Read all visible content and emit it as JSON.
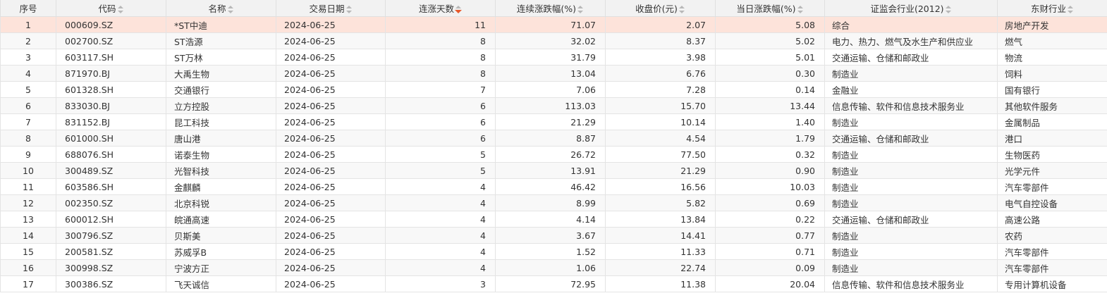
{
  "table": {
    "columns": {
      "idx": "序号",
      "code": "代码",
      "name": "名称",
      "date": "交易日期",
      "days": "连涨天数",
      "gain": "连续涨跌幅(%)",
      "close": "收盘价(元)",
      "daily": "当日涨跌幅(%)",
      "csrc": "证监会行业(2012)",
      "em": "东财行业"
    },
    "sorted_column": "days",
    "sort_direction": "desc",
    "selected_row": 1,
    "accent_color": "#e8592b",
    "selected_row_color": "#fde3da",
    "rows": [
      {
        "idx": "1",
        "code": "000609.SZ",
        "name": "*ST中迪",
        "date": "2024-06-25",
        "days": "11",
        "gain": "71.07",
        "close": "2.07",
        "daily": "5.08",
        "csrc": "综合",
        "em": "房地产开发"
      },
      {
        "idx": "2",
        "code": "002700.SZ",
        "name": "ST浩源",
        "date": "2024-06-25",
        "days": "8",
        "gain": "32.02",
        "close": "8.37",
        "daily": "5.02",
        "csrc": "电力、热力、燃气及水生产和供应业",
        "em": "燃气"
      },
      {
        "idx": "3",
        "code": "603117.SH",
        "name": "ST万林",
        "date": "2024-06-25",
        "days": "8",
        "gain": "31.79",
        "close": "3.98",
        "daily": "5.01",
        "csrc": "交通运输、仓储和邮政业",
        "em": "物流"
      },
      {
        "idx": "4",
        "code": "871970.BJ",
        "name": "大禹生物",
        "date": "2024-06-25",
        "days": "8",
        "gain": "13.04",
        "close": "6.76",
        "daily": "0.30",
        "csrc": "制造业",
        "em": "饲料"
      },
      {
        "idx": "5",
        "code": "601328.SH",
        "name": "交通银行",
        "date": "2024-06-25",
        "days": "7",
        "gain": "7.06",
        "close": "7.28",
        "daily": "0.14",
        "csrc": "金融业",
        "em": "国有银行"
      },
      {
        "idx": "6",
        "code": "833030.BJ",
        "name": "立方控股",
        "date": "2024-06-25",
        "days": "6",
        "gain": "113.03",
        "close": "15.70",
        "daily": "13.44",
        "csrc": "信息传输、软件和信息技术服务业",
        "em": "其他软件服务"
      },
      {
        "idx": "7",
        "code": "831152.BJ",
        "name": "昆工科技",
        "date": "2024-06-25",
        "days": "6",
        "gain": "21.29",
        "close": "10.14",
        "daily": "1.40",
        "csrc": "制造业",
        "em": "金属制品"
      },
      {
        "idx": "8",
        "code": "601000.SH",
        "name": "唐山港",
        "date": "2024-06-25",
        "days": "6",
        "gain": "8.87",
        "close": "4.54",
        "daily": "1.79",
        "csrc": "交通运输、仓储和邮政业",
        "em": "港口"
      },
      {
        "idx": "9",
        "code": "688076.SH",
        "name": "诺泰生物",
        "date": "2024-06-25",
        "days": "5",
        "gain": "26.72",
        "close": "77.50",
        "daily": "0.32",
        "csrc": "制造业",
        "em": "生物医药"
      },
      {
        "idx": "10",
        "code": "300489.SZ",
        "name": "光智科技",
        "date": "2024-06-25",
        "days": "5",
        "gain": "13.91",
        "close": "21.29",
        "daily": "0.90",
        "csrc": "制造业",
        "em": "光学元件"
      },
      {
        "idx": "11",
        "code": "603586.SH",
        "name": "金麒麟",
        "date": "2024-06-25",
        "days": "4",
        "gain": "46.42",
        "close": "16.56",
        "daily": "10.03",
        "csrc": "制造业",
        "em": "汽车零部件"
      },
      {
        "idx": "12",
        "code": "002350.SZ",
        "name": "北京科锐",
        "date": "2024-06-25",
        "days": "4",
        "gain": "8.99",
        "close": "5.82",
        "daily": "0.69",
        "csrc": "制造业",
        "em": "电气自控设备"
      },
      {
        "idx": "13",
        "code": "600012.SH",
        "name": "皖通高速",
        "date": "2024-06-25",
        "days": "4",
        "gain": "4.14",
        "close": "13.84",
        "daily": "0.22",
        "csrc": "交通运输、仓储和邮政业",
        "em": "高速公路"
      },
      {
        "idx": "14",
        "code": "300796.SZ",
        "name": "贝斯美",
        "date": "2024-06-25",
        "days": "4",
        "gain": "3.67",
        "close": "14.41",
        "daily": "0.77",
        "csrc": "制造业",
        "em": "农药"
      },
      {
        "idx": "15",
        "code": "200581.SZ",
        "name": "苏威孚B",
        "date": "2024-06-25",
        "days": "4",
        "gain": "1.52",
        "close": "11.33",
        "daily": "0.71",
        "csrc": "制造业",
        "em": "汽车零部件"
      },
      {
        "idx": "16",
        "code": "300998.SZ",
        "name": "宁波方正",
        "date": "2024-06-25",
        "days": "4",
        "gain": "1.06",
        "close": "22.74",
        "daily": "0.09",
        "csrc": "制造业",
        "em": "汽车零部件"
      },
      {
        "idx": "17",
        "code": "300386.SZ",
        "name": "飞天诚信",
        "date": "2024-06-25",
        "days": "3",
        "gain": "72.95",
        "close": "11.38",
        "daily": "20.04",
        "csrc": "信息传输、软件和信息技术服务业",
        "em": "专用计算机设备"
      }
    ]
  }
}
